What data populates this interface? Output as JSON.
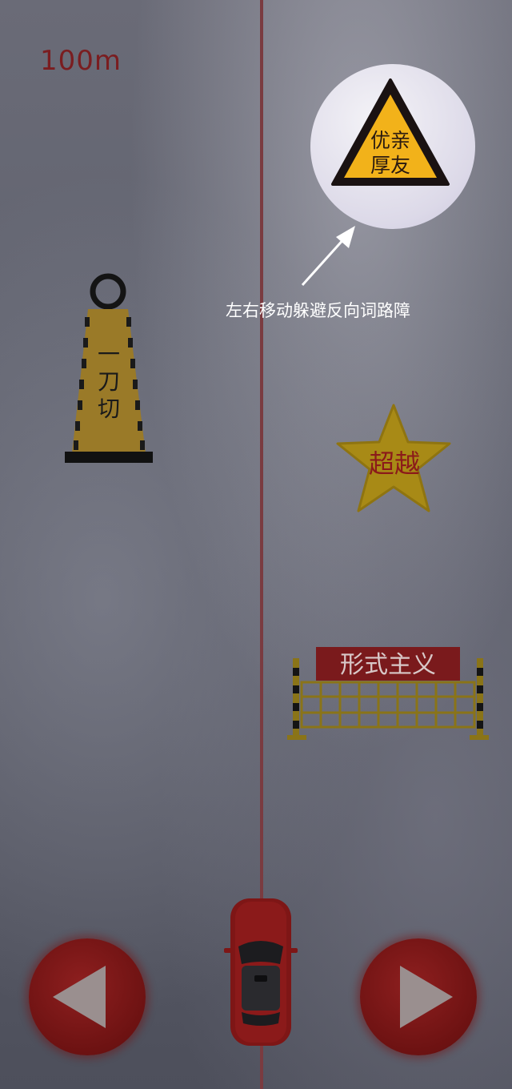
{
  "hud": {
    "distance": "100m"
  },
  "hint": {
    "sign_text_line1": "优亲",
    "sign_text_line2": "厚友",
    "text": "左右移动躲避反向词路障"
  },
  "obstacles": {
    "cone_text": [
      "一",
      "刀",
      "切"
    ],
    "star_text": "超越",
    "barrier_text": "形式主义"
  },
  "controls": {
    "left_icon": "triangle-left-icon",
    "right_icon": "triangle-right-icon"
  },
  "colors": {
    "lane_line": "#7a3b40",
    "distance_text": "#7a1d20",
    "sign_yellow": "#f2b21a",
    "button_red": "#7a1515",
    "car_red": "#8b1a1a"
  }
}
